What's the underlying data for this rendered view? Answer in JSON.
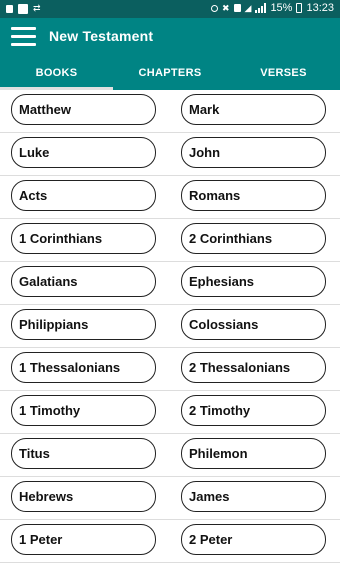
{
  "status_bar": {
    "battery_percent": "15%",
    "time": "13:23"
  },
  "app_bar": {
    "title": "New Testament",
    "menu_icon": "hamburger-menu-icon"
  },
  "tabs": [
    {
      "label": "BOOKS",
      "active": true
    },
    {
      "label": "CHAPTERS",
      "active": false
    },
    {
      "label": "VERSES",
      "active": false
    }
  ],
  "books": [
    [
      "Matthew",
      "Mark"
    ],
    [
      "Luke",
      "John"
    ],
    [
      "Acts",
      "Romans"
    ],
    [
      "1 Corinthians",
      "2 Corinthians"
    ],
    [
      "Galatians",
      "Ephesians"
    ],
    [
      "Philippians",
      "Colossians"
    ],
    [
      "1 Thessalonians",
      "2 Thessalonians"
    ],
    [
      "1 Timothy",
      "2 Timothy"
    ],
    [
      "Titus",
      "Philemon"
    ],
    [
      "Hebrews",
      "James"
    ],
    [
      "1 Peter",
      "2 Peter"
    ]
  ],
  "colors": {
    "status_bar": "#0b5f5f",
    "app_bar": "#008484",
    "tab_indicator": "#e0e0e0",
    "pill_border": "#222222"
  }
}
